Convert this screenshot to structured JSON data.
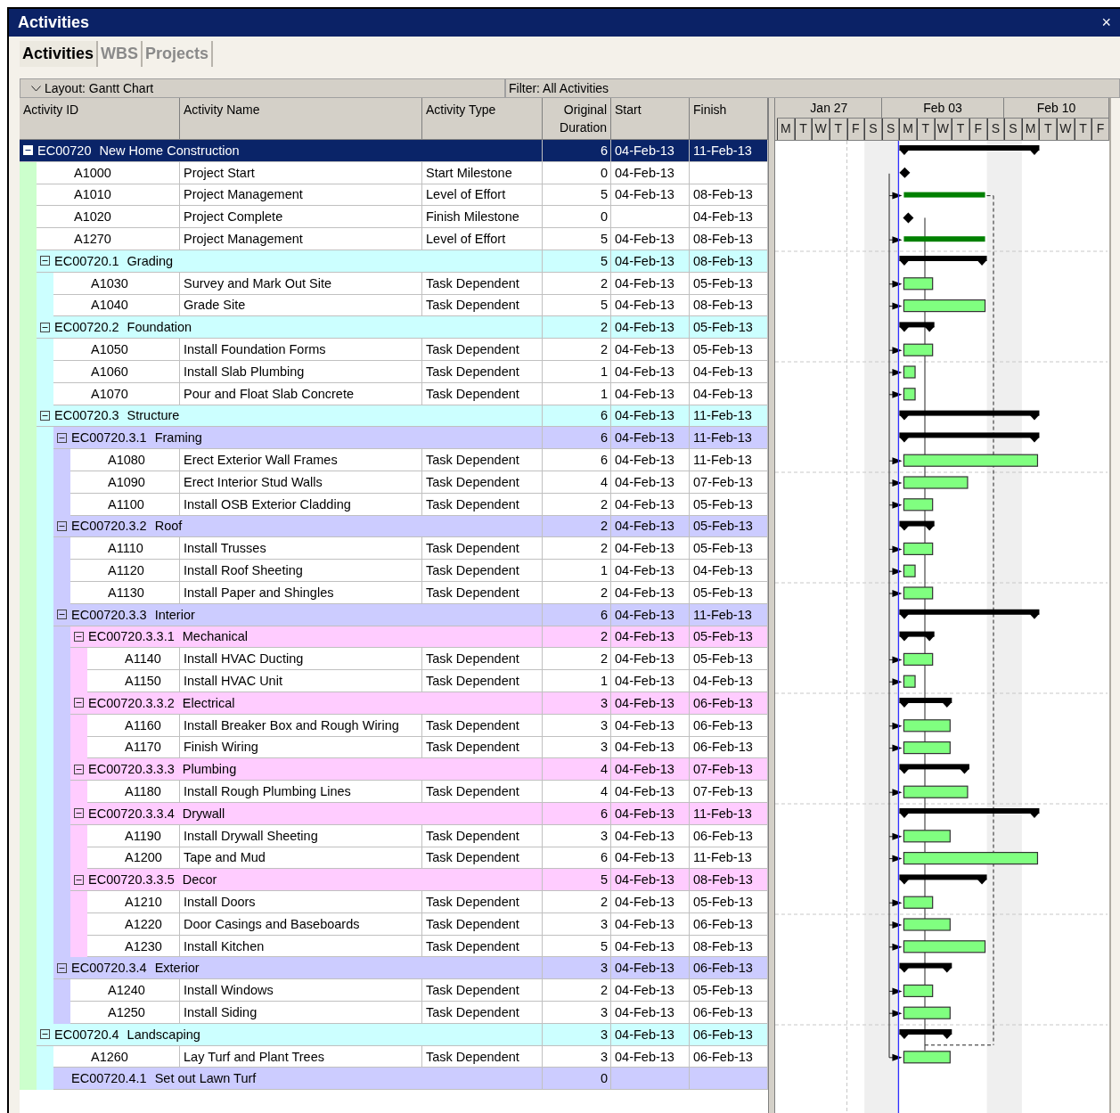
{
  "window": {
    "title": "Activities",
    "close": "×"
  },
  "tabs": [
    {
      "label": "Activities",
      "selected": true
    },
    {
      "label": "WBS",
      "selected": false
    },
    {
      "label": "Projects",
      "selected": false
    }
  ],
  "layout_bar": {
    "layout": "Layout: Gantt Chart",
    "filter": "Filter: All Activities"
  },
  "columns": [
    "Activity ID",
    "Activity Name",
    "Activity Type",
    "Original Duration",
    "Start",
    "Finish"
  ],
  "timescale": {
    "weeks": [
      "Jan 27",
      "Feb 03",
      "Feb 10"
    ],
    "days": [
      "M",
      "T",
      "W",
      "T",
      "F",
      "S",
      "S",
      "M",
      "T",
      "W",
      "T",
      "F",
      "S",
      "S",
      "M",
      "T",
      "W",
      "T",
      "F"
    ]
  },
  "rows": [
    {
      "kind": "wbs",
      "id": "EC00720",
      "name": "New Home Construction",
      "duration": "6",
      "start": "04-Feb-13",
      "finish": "11-Feb-13",
      "expanded": true,
      "selected": true,
      "children": [
        {
          "kind": "start_milestone",
          "id": "A1000",
          "name": "Project Start",
          "type": "Start Milestone",
          "duration": "0",
          "start": "04-Feb-13",
          "selected": false
        },
        {
          "kind": "level_of_effort",
          "id": "A1010",
          "name": "Project Management",
          "type": "Level of Effort",
          "duration": "5",
          "start": "04-Feb-13",
          "finish": "08-Feb-13",
          "selected": false
        },
        {
          "kind": "finish_milestone",
          "id": "A1020",
          "name": "Project Complete",
          "type": "Finish Milestone",
          "duration": "0",
          "finish": "04-Feb-13",
          "selected": false
        },
        {
          "kind": "level_of_effort",
          "id": "A1270",
          "name": "Project Management",
          "type": "Level of Effort",
          "duration": "5",
          "start": "04-Feb-13",
          "finish": "08-Feb-13",
          "selected": false
        },
        {
          "kind": "wbs",
          "id": "EC00720.1",
          "name": "Grading",
          "duration": "5",
          "start": "04-Feb-13",
          "finish": "08-Feb-13",
          "expanded": true,
          "selected": false,
          "children": [
            {
              "kind": "task",
              "id": "A1030",
              "name": "Survey and Mark Out Site",
              "type": "Task Dependent",
              "duration": "2",
              "start": "04-Feb-13",
              "finish": "05-Feb-13",
              "selected": false
            },
            {
              "kind": "task",
              "id": "A1040",
              "name": "Grade Site",
              "type": "Task Dependent",
              "duration": "5",
              "start": "04-Feb-13",
              "finish": "08-Feb-13",
              "selected": false
            }
          ]
        },
        {
          "kind": "wbs",
          "id": "EC00720.2",
          "name": "Foundation",
          "duration": "2",
          "start": "04-Feb-13",
          "finish": "05-Feb-13",
          "expanded": true,
          "selected": false,
          "children": [
            {
              "kind": "task",
              "id": "A1050",
              "name": "Install Foundation Forms",
              "type": "Task Dependent",
              "duration": "2",
              "start": "04-Feb-13",
              "finish": "05-Feb-13",
              "selected": false
            },
            {
              "kind": "task",
              "id": "A1060",
              "name": "Install Slab Plumbing",
              "type": "Task Dependent",
              "duration": "1",
              "start": "04-Feb-13",
              "finish": "04-Feb-13",
              "selected": false
            },
            {
              "kind": "task",
              "id": "A1070",
              "name": "Pour and Float Slab Concrete",
              "type": "Task Dependent",
              "duration": "1",
              "start": "04-Feb-13",
              "finish": "04-Feb-13",
              "selected": false
            }
          ]
        },
        {
          "kind": "wbs",
          "id": "EC00720.3",
          "name": "Structure",
          "duration": "6",
          "start": "04-Feb-13",
          "finish": "11-Feb-13",
          "expanded": true,
          "selected": false,
          "children": [
            {
              "kind": "wbs",
              "id": "EC00720.3.1",
              "name": "Framing",
              "duration": "6",
              "start": "04-Feb-13",
              "finish": "11-Feb-13",
              "expanded": true,
              "selected": false,
              "children": [
                {
                  "kind": "task",
                  "id": "A1080",
                  "name": "Erect Exterior Wall Frames",
                  "type": "Task Dependent",
                  "duration": "6",
                  "start": "04-Feb-13",
                  "finish": "11-Feb-13",
                  "selected": false
                },
                {
                  "kind": "task",
                  "id": "A1090",
                  "name": "Erect Interior Stud Walls",
                  "type": "Task Dependent",
                  "duration": "4",
                  "start": "04-Feb-13",
                  "finish": "07-Feb-13",
                  "selected": false
                },
                {
                  "kind": "task",
                  "id": "A1100",
                  "name": "Install OSB Exterior Cladding",
                  "type": "Task Dependent",
                  "duration": "2",
                  "start": "04-Feb-13",
                  "finish": "05-Feb-13",
                  "selected": false
                }
              ]
            },
            {
              "kind": "wbs",
              "id": "EC00720.3.2",
              "name": "Roof",
              "duration": "2",
              "start": "04-Feb-13",
              "finish": "05-Feb-13",
              "expanded": true,
              "selected": false,
              "children": [
                {
                  "kind": "task",
                  "id": "A1110",
                  "name": "Install Trusses",
                  "type": "Task Dependent",
                  "duration": "2",
                  "start": "04-Feb-13",
                  "finish": "05-Feb-13",
                  "selected": false
                },
                {
                  "kind": "task",
                  "id": "A1120",
                  "name": "Install Roof Sheeting",
                  "type": "Task Dependent",
                  "duration": "1",
                  "start": "04-Feb-13",
                  "finish": "04-Feb-13",
                  "selected": false
                },
                {
                  "kind": "task",
                  "id": "A1130",
                  "name": "Install Paper and Shingles",
                  "type": "Task Dependent",
                  "duration": "2",
                  "start": "04-Feb-13",
                  "finish": "05-Feb-13",
                  "selected": false
                }
              ]
            },
            {
              "kind": "wbs",
              "id": "EC00720.3.3",
              "name": "Interior",
              "duration": "6",
              "start": "04-Feb-13",
              "finish": "11-Feb-13",
              "expanded": true,
              "selected": false,
              "children": [
                {
                  "kind": "wbs",
                  "id": "EC00720.3.3.1",
                  "name": "Mechanical",
                  "duration": "2",
                  "start": "04-Feb-13",
                  "finish": "05-Feb-13",
                  "expanded": true,
                  "selected": false,
                  "children": [
                    {
                      "kind": "task",
                      "id": "A1140",
                      "name": "Install HVAC Ducting",
                      "type": "Task Dependent",
                      "duration": "2",
                      "start": "04-Feb-13",
                      "finish": "05-Feb-13",
                      "selected": false
                    },
                    {
                      "kind": "task",
                      "id": "A1150",
                      "name": "Install HVAC Unit",
                      "type": "Task Dependent",
                      "duration": "1",
                      "start": "04-Feb-13",
                      "finish": "04-Feb-13",
                      "selected": false
                    }
                  ]
                },
                {
                  "kind": "wbs",
                  "id": "EC00720.3.3.2",
                  "name": "Electrical",
                  "duration": "3",
                  "start": "04-Feb-13",
                  "finish": "06-Feb-13",
                  "expanded": true,
                  "selected": false,
                  "children": [
                    {
                      "kind": "task",
                      "id": "A1160",
                      "name": "Install Breaker Box and Rough Wiring",
                      "type": "Task Dependent",
                      "duration": "3",
                      "start": "04-Feb-13",
                      "finish": "06-Feb-13",
                      "selected": false
                    },
                    {
                      "kind": "task",
                      "id": "A1170",
                      "name": "Finish Wiring",
                      "type": "Task Dependent",
                      "duration": "3",
                      "start": "04-Feb-13",
                      "finish": "06-Feb-13",
                      "selected": false
                    }
                  ]
                },
                {
                  "kind": "wbs",
                  "id": "EC00720.3.3.3",
                  "name": "Plumbing",
                  "duration": "4",
                  "start": "04-Feb-13",
                  "finish": "07-Feb-13",
                  "expanded": true,
                  "selected": false,
                  "children": [
                    {
                      "kind": "task",
                      "id": "A1180",
                      "name": "Install Rough Plumbing Lines",
                      "type": "Task Dependent",
                      "duration": "4",
                      "start": "04-Feb-13",
                      "finish": "07-Feb-13",
                      "selected": false
                    }
                  ]
                },
                {
                  "kind": "wbs",
                  "id": "EC00720.3.3.4",
                  "name": "Drywall",
                  "duration": "6",
                  "start": "04-Feb-13",
                  "finish": "11-Feb-13",
                  "expanded": true,
                  "selected": false,
                  "children": [
                    {
                      "kind": "task",
                      "id": "A1190",
                      "name": "Install Drywall Sheeting",
                      "type": "Task Dependent",
                      "duration": "3",
                      "start": "04-Feb-13",
                      "finish": "06-Feb-13",
                      "selected": false
                    },
                    {
                      "kind": "task",
                      "id": "A1200",
                      "name": "Tape and Mud",
                      "type": "Task Dependent",
                      "duration": "6",
                      "start": "04-Feb-13",
                      "finish": "11-Feb-13",
                      "selected": false
                    }
                  ]
                },
                {
                  "kind": "wbs",
                  "id": "EC00720.3.3.5",
                  "name": "Decor",
                  "duration": "5",
                  "start": "04-Feb-13",
                  "finish": "08-Feb-13",
                  "expanded": true,
                  "selected": false,
                  "children": [
                    {
                      "kind": "task",
                      "id": "A1210",
                      "name": "Install Doors",
                      "type": "Task Dependent",
                      "duration": "2",
                      "start": "04-Feb-13",
                      "finish": "05-Feb-13",
                      "selected": false
                    },
                    {
                      "kind": "task",
                      "id": "A1220",
                      "name": "Door Casings and Baseboards",
                      "type": "Task Dependent",
                      "duration": "3",
                      "start": "04-Feb-13",
                      "finish": "06-Feb-13",
                      "selected": false
                    },
                    {
                      "kind": "task",
                      "id": "A1230",
                      "name": "Install Kitchen",
                      "type": "Task Dependent",
                      "duration": "5",
                      "start": "04-Feb-13",
                      "finish": "08-Feb-13",
                      "selected": false
                    }
                  ]
                }
              ]
            },
            {
              "kind": "wbs",
              "id": "EC00720.3.4",
              "name": "Exterior",
              "duration": "3",
              "start": "04-Feb-13",
              "finish": "06-Feb-13",
              "expanded": true,
              "selected": false,
              "children": [
                {
                  "kind": "task",
                  "id": "A1240",
                  "name": "Install Windows",
                  "type": "Task Dependent",
                  "duration": "2",
                  "start": "04-Feb-13",
                  "finish": "05-Feb-13",
                  "selected": false
                },
                {
                  "kind": "task",
                  "id": "A1250",
                  "name": "Install Siding",
                  "type": "Task Dependent",
                  "duration": "3",
                  "start": "04-Feb-13",
                  "finish": "06-Feb-13",
                  "selected": false
                }
              ]
            }
          ]
        },
        {
          "kind": "wbs",
          "id": "EC00720.4",
          "name": "Landscaping",
          "duration": "3",
          "start": "04-Feb-13",
          "finish": "06-Feb-13",
          "expanded": true,
          "selected": false,
          "children": [
            {
              "kind": "task",
              "id": "A1260",
              "name": "Lay Turf and Plant Trees",
              "type": "Task Dependent",
              "duration": "3",
              "start": "04-Feb-13",
              "finish": "06-Feb-13",
              "selected": false
            },
            {
              "kind": "wbs",
              "id": "EC00720.4.1",
              "name": "Set out Lawn Turf",
              "duration": "0",
              "selected": false
            }
          ]
        }
      ]
    }
  ]
}
